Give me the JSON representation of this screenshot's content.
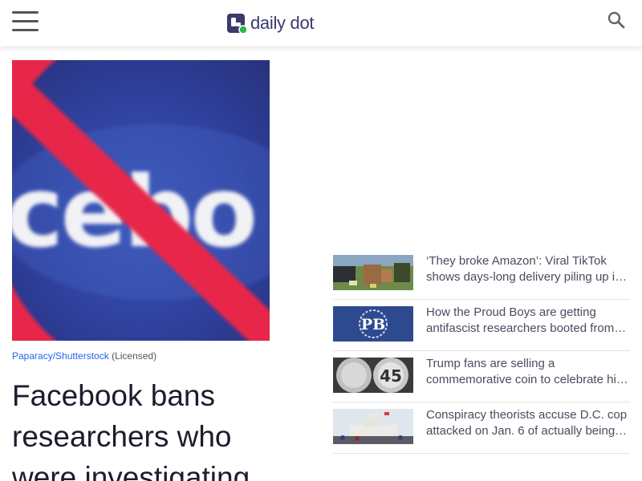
{
  "header": {
    "logo_text": "daily dot",
    "menu_icon": "hamburger-menu-icon",
    "search_icon": "search-icon",
    "brand_color": "#3b3a6b",
    "accent_color": "#2db84d"
  },
  "hero": {
    "image_subject": "Facebook logo with red prohibition sign",
    "image_text": "cebo",
    "credit_source": "Paparacy/Shutterstock",
    "credit_license": "(Licensed)"
  },
  "article": {
    "headline": "Facebook bans researchers who were investigating"
  },
  "related": [
    {
      "title": "‘They broke Amazon’: Viral TikTok shows days-long delivery piling up i…",
      "thumb_icon": "delivery-photo"
    },
    {
      "title": "How the Proud Boys are getting antifascist researchers booted from…",
      "thumb_icon": "proud-boys-logo"
    },
    {
      "title": "Trump fans are selling a commemorative coin to celebrate hi…",
      "thumb_icon": "coin-photo",
      "thumb_text": "45"
    },
    {
      "title": "Conspiracy theorists accuse D.C. cop attacked on Jan. 6 of actually being…",
      "thumb_icon": "capitol-photo"
    }
  ]
}
